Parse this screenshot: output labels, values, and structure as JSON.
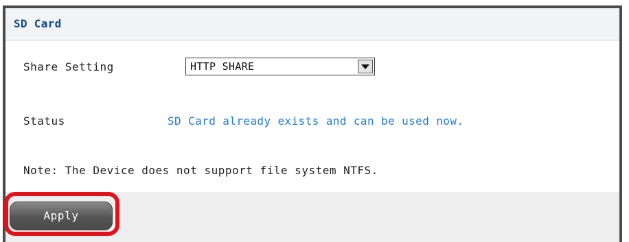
{
  "panel": {
    "title": "SD Card"
  },
  "share_setting": {
    "label": "Share Setting",
    "selected": "HTTP SHARE"
  },
  "status": {
    "label": "Status",
    "value": "SD Card already exists and can be used now."
  },
  "note": "Note: The Device does not support file system NTFS.",
  "actions": {
    "apply_label": "Apply"
  },
  "colors": {
    "title": "#114a8a",
    "status": "#1f7bd6",
    "highlight": "#e0131c"
  }
}
